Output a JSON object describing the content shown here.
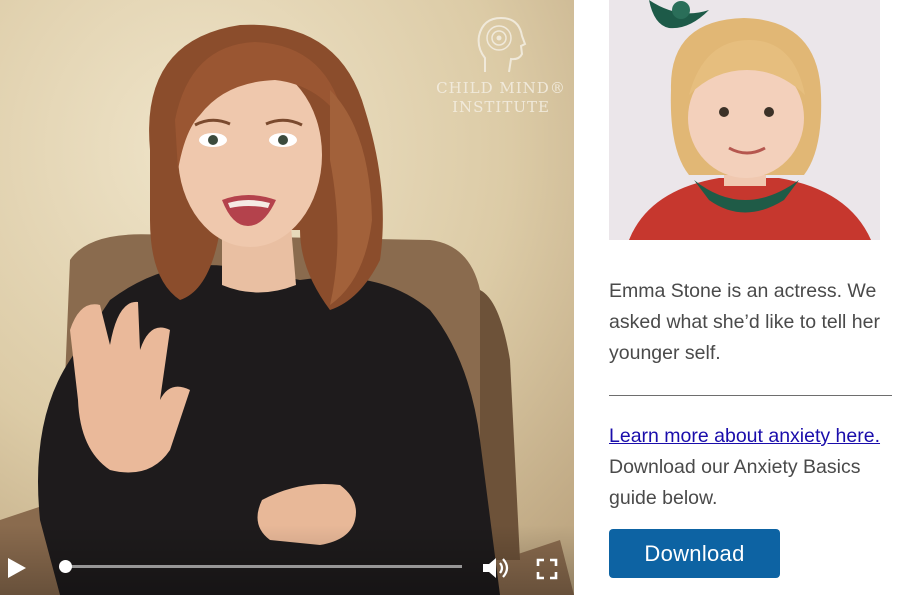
{
  "video": {
    "watermark_line1": "Child Mind®",
    "watermark_line2": "Institute",
    "progress": 0.0,
    "controls": {
      "play_icon": "play-icon",
      "volume_icon": "volume-icon",
      "fullscreen_icon": "fullscreen-icon"
    }
  },
  "sidebar": {
    "caption": "Emma Stone is an actress. We asked what she’d like to tell her younger self.",
    "link_text": "Learn more about anxiety here.",
    "link_suffix": " Download our Anxiety Basics guide below.",
    "download_label": "Download"
  },
  "colors": {
    "link": "#1a0dab",
    "button": "#0d63a3",
    "text": "#4a4a4a"
  }
}
